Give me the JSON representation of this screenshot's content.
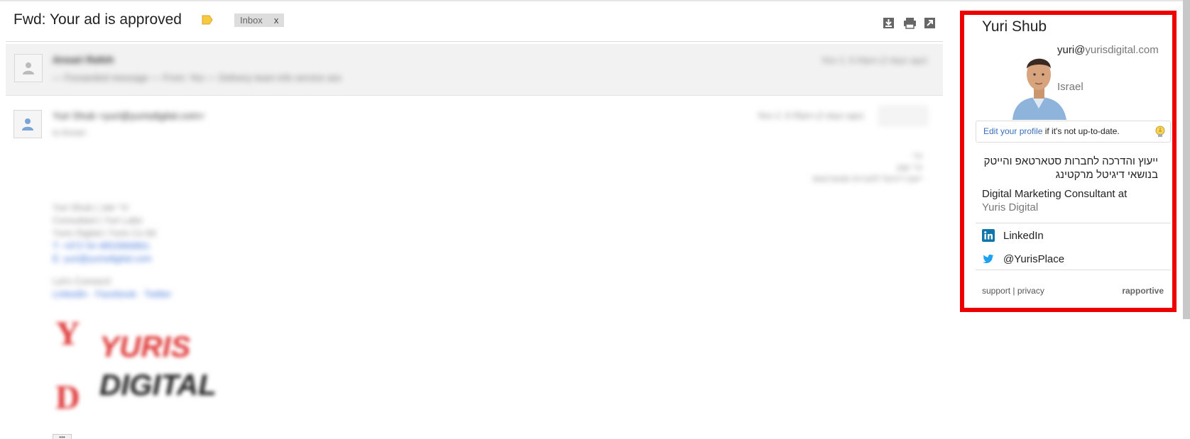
{
  "email": {
    "subject": "Fwd: Your ad is approved",
    "label_chip": "Inbox",
    "label_chip_close": "x",
    "label_color": "#f7c942",
    "actions": [
      "download-icon",
      "print-icon",
      "new-window-icon"
    ],
    "collapsed_message": {
      "sender": "Ansari Rafeh",
      "snippet": "— Forwarded message — From: Yes — Delivery team info service ass",
      "date": "Nov 2, 6:34pm (2 days ago)"
    },
    "open_message": {
      "sender": "Yuri Shub <yuri@yurisdigital.com>",
      "to": "to Ansari",
      "date": "Nov 2, 6:35pm (2 days ago)",
      "rtl_lines": [
        "יורי",
        "יורי שוב",
        "ייעוץ דיגיטל לחברות סטארטאפ"
      ],
      "signature": {
        "lines": [
          "Yuri Shub | יורי שוב",
          "Consultant | Yuri Labs",
          "Yuris Digital | Yuris Co ltd"
        ],
        "phone": "T: +972 54 4852866861",
        "mail": "E: yuri@yurisdigital.com",
        "connect": "Let's Connect!",
        "social_links": "LinkedIn · Facebook · Twitter"
      },
      "logo_text": {
        "letter": "Y",
        "letter2": "D",
        "line1": "YURIS",
        "line2": "DIGITAL"
      },
      "ellipsis": "•••"
    }
  },
  "rapportive": {
    "name": "Yuri Shub",
    "email_local": "yuri@",
    "email_domain": "yurisdigital.com",
    "location": "Israel",
    "edit_link": "Edit your profile",
    "edit_suffix": " if it's not up-to-date.",
    "bio_hebrew": "ייעוץ והדרכה לחברות סטארטאפ והייטק בנושאי דיגיטל מרקטינג",
    "occupation_title": "Digital Marketing Consultant at",
    "occupation_company": "Yuris Digital",
    "socials": [
      {
        "label": "LinkedIn",
        "icon": "linkedin-icon",
        "color": "#0e76a8"
      },
      {
        "label": "@YurisPlace",
        "icon": "twitter-icon",
        "color": "#1da1f2"
      }
    ],
    "footer_support": "support",
    "footer_separator": " | ",
    "footer_privacy": "privacy",
    "footer_brand": "rapportive",
    "highlight_color": "#ee0000"
  }
}
